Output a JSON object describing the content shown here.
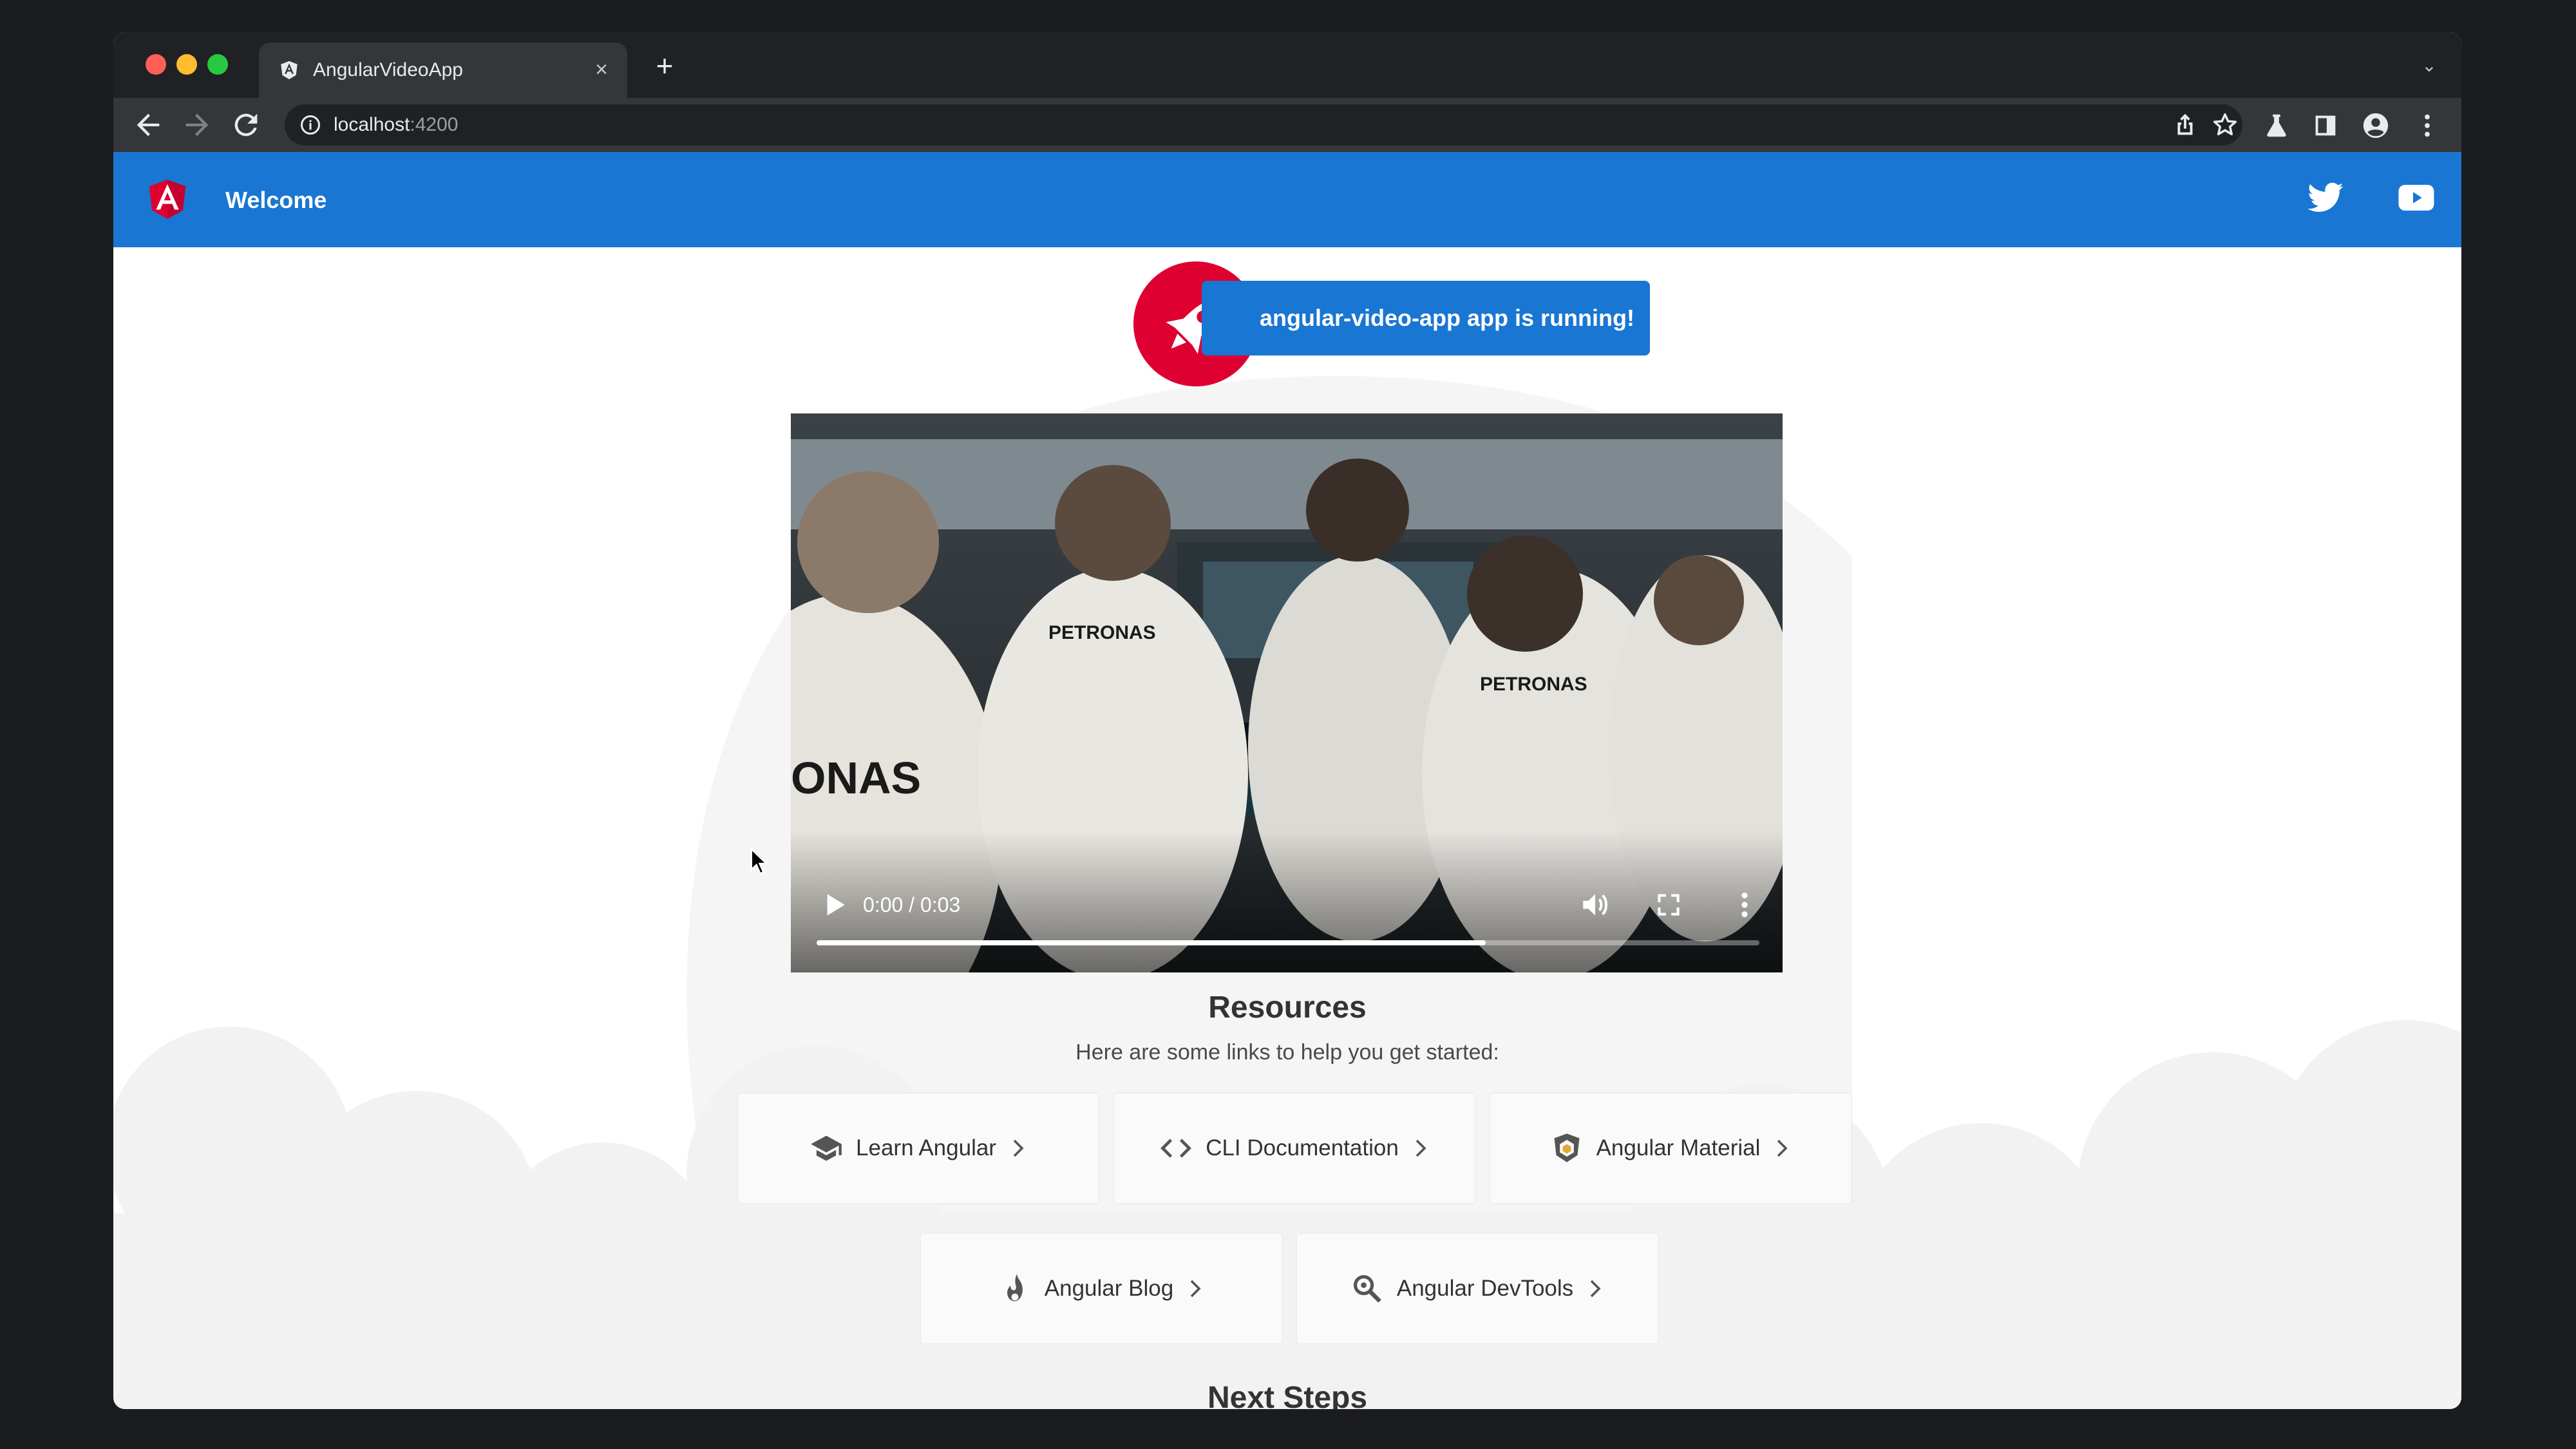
{
  "browser": {
    "tab_title": "AngularVideoApp",
    "tab_close": "×",
    "new_tab": "+",
    "tab_list": "⌄",
    "url_host": "localhost",
    "url_port": ":4200"
  },
  "app_bar": {
    "title": "Welcome"
  },
  "running_banner": {
    "text": "angular-video-app app is running!"
  },
  "video": {
    "time": "0:00 / 0:03",
    "progress": 0.71
  },
  "resources": {
    "title": "Resources",
    "subtitle": "Here are some links to help you get started:",
    "cards": [
      {
        "label": "Learn Angular",
        "icon": "school-icon"
      },
      {
        "label": "CLI Documentation",
        "icon": "code-icon"
      },
      {
        "label": "Angular Material",
        "icon": "material-shield-icon"
      },
      {
        "label": "Angular Blog",
        "icon": "flame-icon"
      },
      {
        "label": "Angular DevTools",
        "icon": "search-icon"
      }
    ]
  },
  "next_steps": {
    "title": "Next Steps"
  },
  "colors": {
    "primary": "#1976d2",
    "angular_red": "#dd0031",
    "chrome_dark": "#202124",
    "chrome_toolbar": "#35363a"
  }
}
